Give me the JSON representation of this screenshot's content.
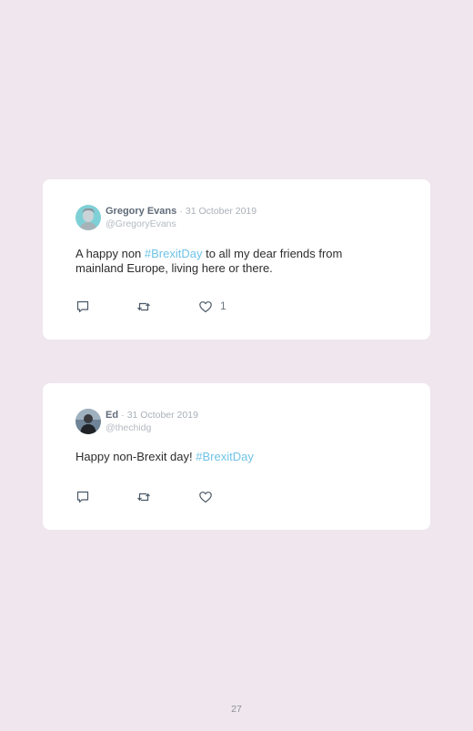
{
  "tweets": [
    {
      "name": "Gregory Evans",
      "separator": "·",
      "date": "31 October 2019",
      "handle": "@GregoryEvans",
      "text_before": "A happy non ",
      "hashtag": "#BrexitDay",
      "text_after": " to all my dear friends from mainland Europe, living here or there.",
      "like_count": "1"
    },
    {
      "name": "Ed",
      "separator": "·",
      "date": "31 October 2019",
      "handle": "@thechidg",
      "text_before": "Happy non-Brexit day! ",
      "hashtag": "#BrexitDay",
      "text_after": ""
    }
  ],
  "page_number": "27",
  "icons": [
    "reply-icon",
    "retweet-icon",
    "like-icon"
  ],
  "colors": {
    "background": "#efe6ee",
    "card": "#ffffff",
    "hashtag": "#6fc3e6",
    "name": "#5f6b78"
  }
}
